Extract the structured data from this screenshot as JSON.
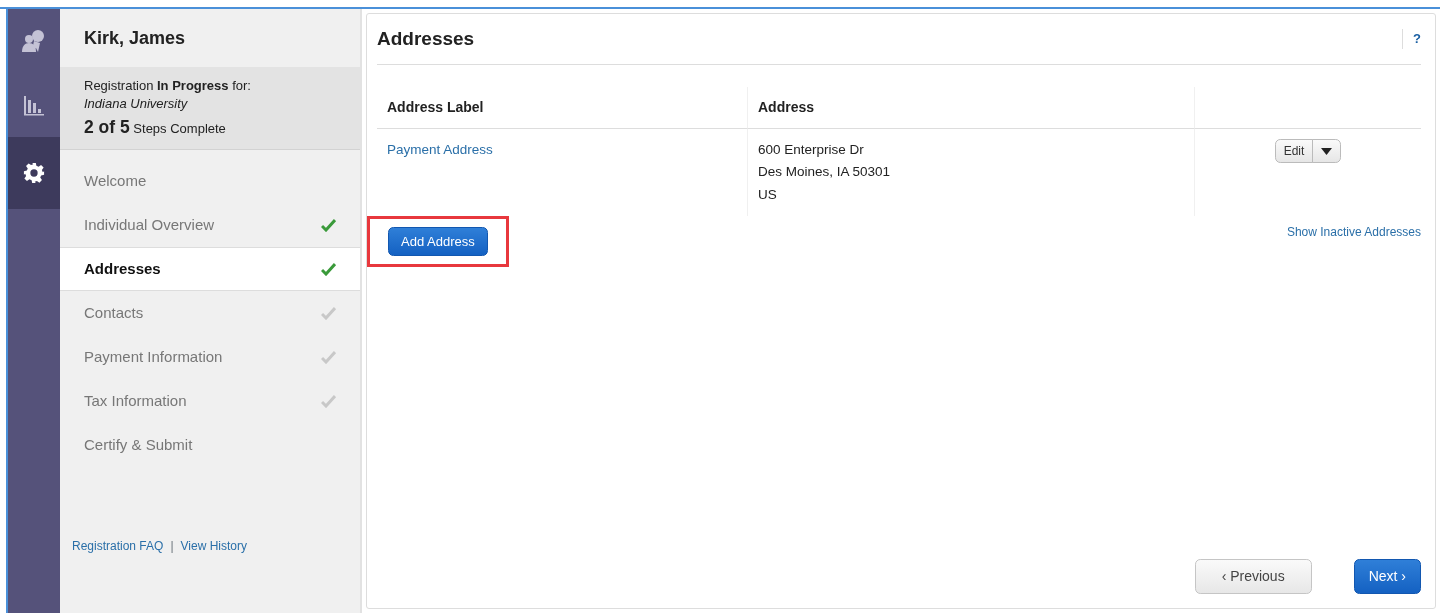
{
  "rail": [
    {
      "selected": false
    },
    {
      "selected": false
    },
    {
      "selected": true
    }
  ],
  "user": {
    "name": "Kirk, James"
  },
  "registration": {
    "status_text": "Registration **In Progress** for:",
    "organization": "Indiana University",
    "progress_count": "2 of 5",
    "progress_label": "Steps Complete"
  },
  "steps": [
    {
      "label": "Welcome",
      "selected": false,
      "kind": "plain"
    },
    {
      "label": "Individual Overview",
      "selected": false,
      "kind": "complete"
    },
    {
      "label": "Addresses",
      "selected": true,
      "kind": "complete"
    },
    {
      "label": "Contacts",
      "selected": false,
      "kind": "pending"
    },
    {
      "label": "Payment Information",
      "selected": false,
      "kind": "pending"
    },
    {
      "label": "Tax Information",
      "selected": false,
      "kind": "pending"
    },
    {
      "label": "Certify & Submit",
      "selected": false,
      "kind": "plain"
    }
  ],
  "footer_links": [
    "Registration FAQ",
    "View History"
  ],
  "footer_separator": "|",
  "main": {
    "title": "Addresses",
    "help": "?",
    "table": {
      "columns": [
        "Address Label",
        "Address"
      ],
      "rows": [
        {
          "label": "Payment Address",
          "address_lines": [
            "600 Enterprise Dr",
            "Des Moines, IA 50301",
            "US"
          ],
          "action": "Edit"
        }
      ]
    },
    "add_button": {
      "label": "Add Address",
      "highlighted": true
    },
    "show_inactive": "Show Inactive Addresses",
    "previous": "‹ Previous",
    "next": "Next ›"
  }
}
